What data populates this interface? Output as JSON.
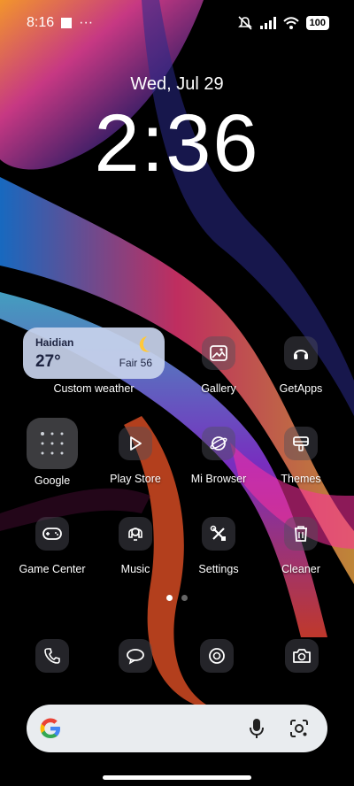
{
  "status_bar": {
    "time": "8:16",
    "extra": "···",
    "battery": "100"
  },
  "clock": {
    "date": "Wed, Jul 29",
    "time": "2:36"
  },
  "weather": {
    "city": "Haidian",
    "temp": "27°",
    "condition": "Fair 56",
    "label": "Custom weather"
  },
  "apps": [
    {
      "label": "Gallery",
      "icon": "gallery-icon"
    },
    {
      "label": "GetApps",
      "icon": "getapps-icon"
    },
    {
      "label": "Google",
      "icon": "google-folder-icon"
    },
    {
      "label": "Play Store",
      "icon": "play-store-icon"
    },
    {
      "label": "Mi Browser",
      "icon": "browser-icon"
    },
    {
      "label": "Themes",
      "icon": "themes-icon"
    },
    {
      "label": "Game Center",
      "icon": "gamepad-icon"
    },
    {
      "label": "Music",
      "icon": "music-icon"
    },
    {
      "label": "Settings",
      "icon": "settings-icon"
    },
    {
      "label": "Cleaner",
      "icon": "cleaner-icon"
    }
  ],
  "dock": [
    {
      "icon": "phone-icon"
    },
    {
      "icon": "messages-icon"
    },
    {
      "icon": "chrome-icon"
    },
    {
      "icon": "camera-icon"
    }
  ],
  "page_indicator": {
    "current": 1,
    "total": 2
  }
}
